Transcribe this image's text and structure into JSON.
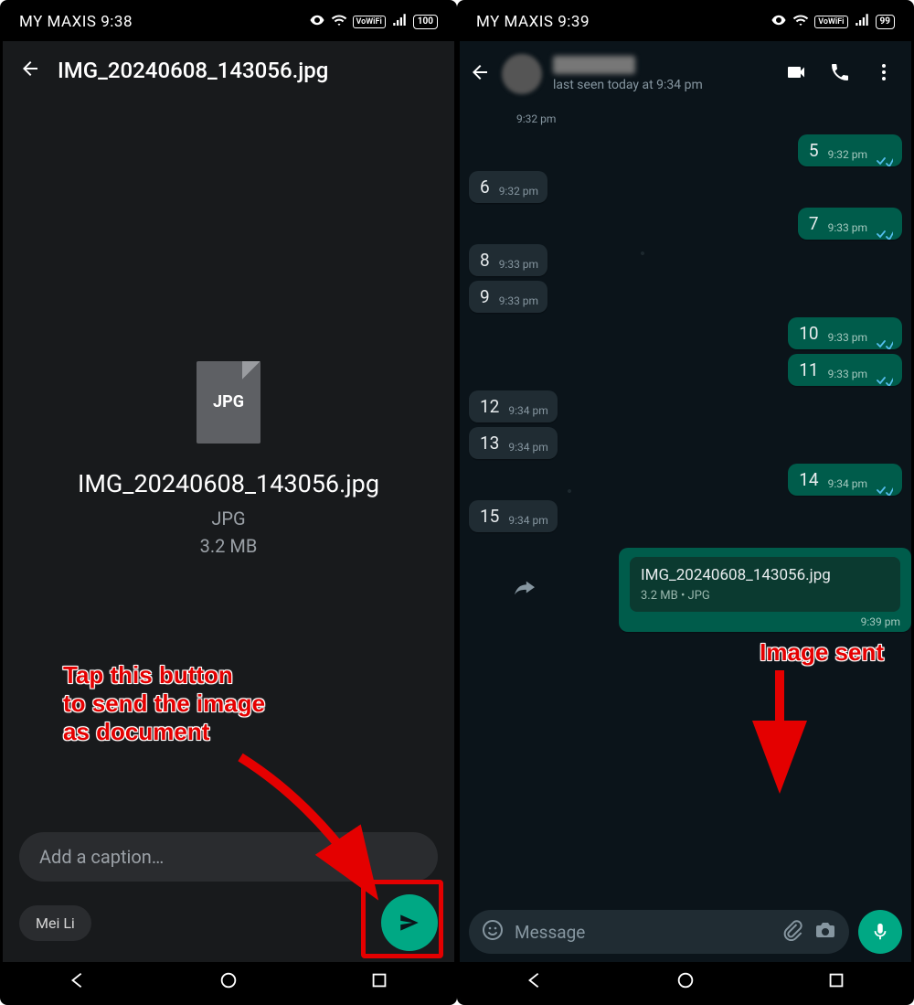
{
  "left": {
    "status": {
      "carrier": "MY MAXIS",
      "time": "9:38",
      "battery": "100"
    },
    "header_title": "IMG_20240608_143056.jpg",
    "file": {
      "icon_label": "JPG",
      "name": "IMG_20240608_143056.jpg",
      "type": "JPG",
      "size": "3.2 MB"
    },
    "caption_placeholder": "Add a caption…",
    "recipient": "Mei Li",
    "annotation": "Tap this button\nto send the image\nas document"
  },
  "right": {
    "status": {
      "carrier": "MY MAXIS",
      "time": "9:39",
      "battery": "99"
    },
    "last_seen": "last seen today at 9:34 pm",
    "messages_top_time": "9:32 pm",
    "messages": [
      {
        "side": "out",
        "text": "5",
        "time": "9:32 pm",
        "read": true
      },
      {
        "side": "in",
        "text": "6",
        "time": "9:32 pm"
      },
      {
        "side": "out",
        "text": "7",
        "time": "9:33 pm",
        "read": true
      },
      {
        "side": "in",
        "text": "8",
        "time": "9:33 pm"
      },
      {
        "side": "in",
        "text": "9",
        "time": "9:33 pm"
      },
      {
        "side": "out",
        "text": "10",
        "time": "9:33 pm",
        "read": true
      },
      {
        "side": "out",
        "text": "11",
        "time": "9:33 pm",
        "read": true
      },
      {
        "side": "in",
        "text": "12",
        "time": "9:34 pm"
      },
      {
        "side": "in",
        "text": "13",
        "time": "9:34 pm"
      },
      {
        "side": "out",
        "text": "14",
        "time": "9:34 pm",
        "read": true
      },
      {
        "side": "in",
        "text": "15",
        "time": "9:34 pm"
      }
    ],
    "doc": {
      "name": "IMG_20240608_143056.jpg",
      "meta": "3.2 MB • JPG",
      "time": "9:39 pm"
    },
    "input_placeholder": "Message",
    "annotation": "Image sent"
  }
}
